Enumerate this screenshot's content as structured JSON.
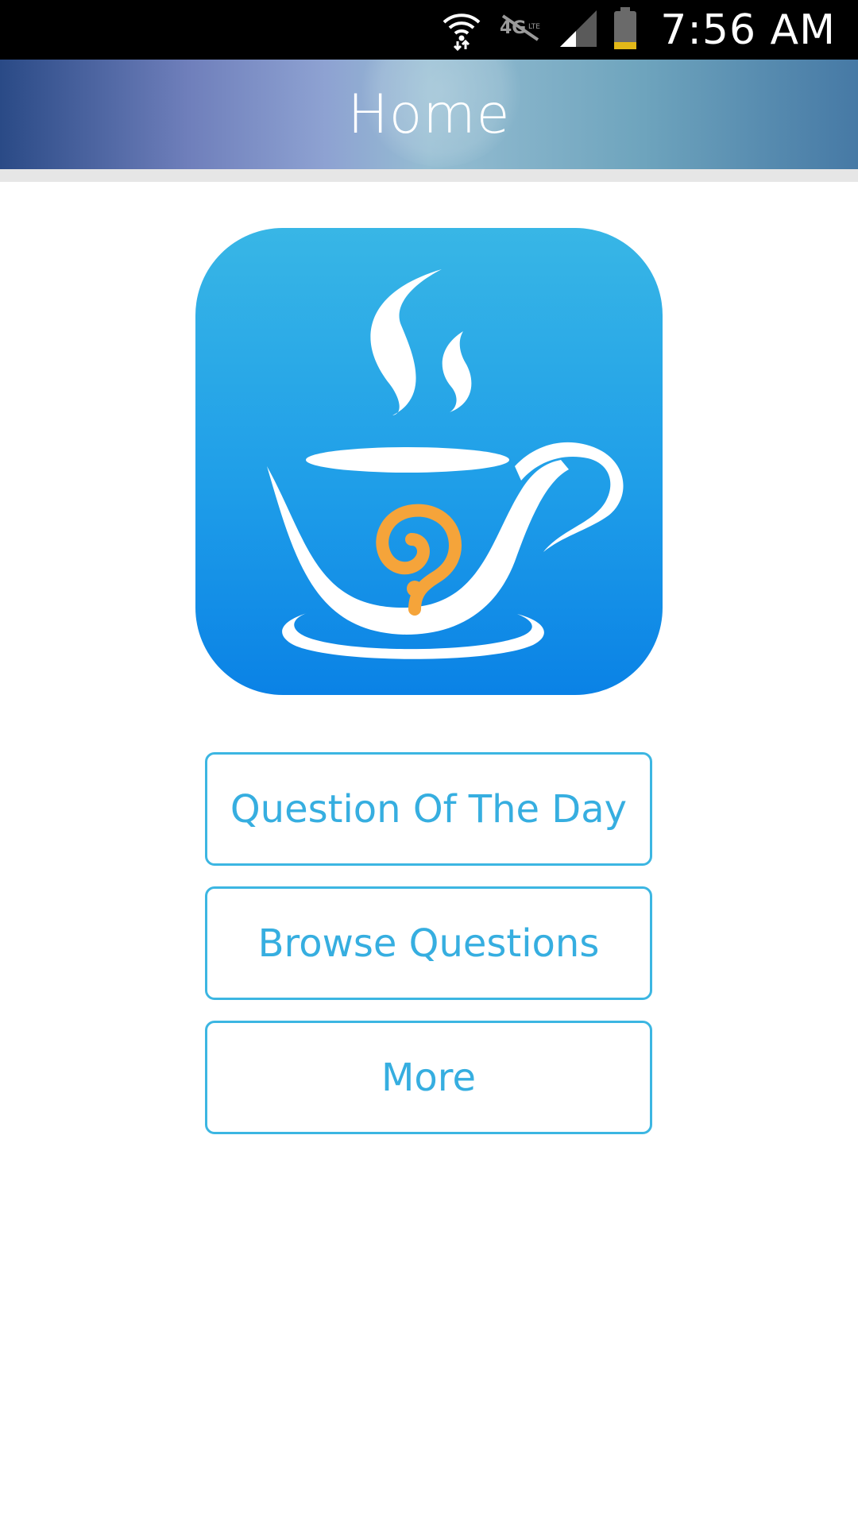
{
  "status_bar": {
    "time": "7:56 AM",
    "icons": [
      "wifi-icon",
      "lte-no-signal-icon",
      "cell-signal-icon",
      "battery-icon"
    ]
  },
  "header": {
    "title": "Home"
  },
  "logo": {
    "icon": "steaming-cup-question-icon",
    "colors": {
      "tile_top": "#38b6e6",
      "tile_bottom": "#0a82e6",
      "question_mark": "#f5a43a"
    }
  },
  "buttons": {
    "question_of_the_day": "Question Of The Day",
    "browse_questions": "Browse Questions",
    "more": "More"
  },
  "colors": {
    "accent": "#36aee0",
    "status_bar": "#000000",
    "background": "#ffffff"
  }
}
